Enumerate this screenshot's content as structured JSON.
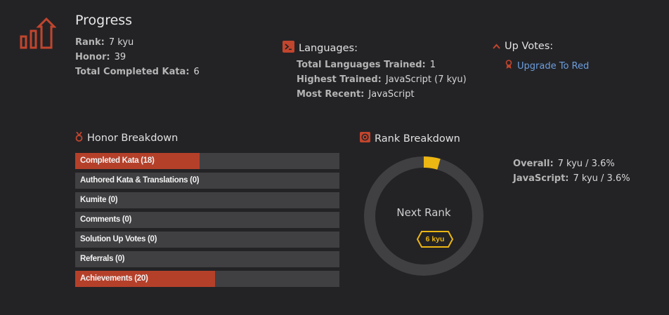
{
  "progress": {
    "title": "Progress",
    "rank_label": "Rank:",
    "rank_value": "7 kyu",
    "honor_label": "Honor:",
    "honor_value": "39",
    "kata_label": "Total Completed Kata:",
    "kata_value": "6"
  },
  "languages": {
    "heading": "Languages:",
    "trained_label": "Total Languages Trained:",
    "trained_value": "1",
    "highest_label": "Highest Trained:",
    "highest_value": "JavaScript (7 kyu)",
    "recent_label": "Most Recent:",
    "recent_value": "JavaScript"
  },
  "upvotes": {
    "heading": "Up Votes:",
    "link": "Upgrade To Red"
  },
  "honor_breakdown": {
    "heading": "Honor Breakdown",
    "items": [
      {
        "label": "Completed Kata (18)",
        "fraction": 0.47
      },
      {
        "label": "Authored Kata & Translations (0)",
        "fraction": 0
      },
      {
        "label": "Kumite (0)",
        "fraction": 0
      },
      {
        "label": "Comments (0)",
        "fraction": 0
      },
      {
        "label": "Solution Up Votes (0)",
        "fraction": 0
      },
      {
        "label": "Referrals (0)",
        "fraction": 0
      },
      {
        "label": "Achievements (20)",
        "fraction": 0.53
      }
    ]
  },
  "rank_breakdown": {
    "heading": "Rank Breakdown",
    "next_rank_label": "Next Rank",
    "next_rank_badge": "6 kyu",
    "progress_fraction": 0.036,
    "overall_label": "Overall:",
    "overall_value": "7 kyu / 3.6%",
    "js_label": "JavaScript:",
    "js_value": "7 kyu / 3.6%"
  },
  "colors": {
    "accent_red": "#b5402a",
    "rank_yellow": "#ecb613",
    "link_blue": "#6d9ede"
  },
  "icons": [
    "progress-chart-icon",
    "terminal-icon",
    "chevron-up-icon",
    "ribbon-icon",
    "medal-icon",
    "target-icon"
  ]
}
